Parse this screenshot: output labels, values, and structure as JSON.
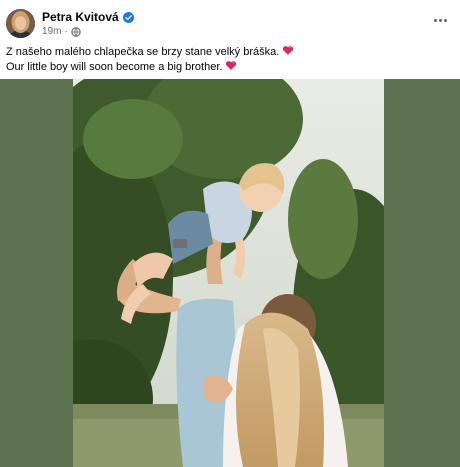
{
  "post": {
    "author": "Petra Kvitová",
    "verified": true,
    "timestamp": "19m",
    "separator": "·",
    "privacy_icon": "globe-icon",
    "more_icon": "more-options-icon",
    "caption": {
      "line1": "Z našeho malého chlapečka se brzy stane velký bráška.",
      "line2": "Our little boy will soon become a big brother.",
      "emoji": "heart-icon"
    }
  },
  "colors": {
    "accent_blue": "#1877f2",
    "media_background": "#5e7250",
    "heart": "#e0245e",
    "secondary_text": "#65676b"
  }
}
